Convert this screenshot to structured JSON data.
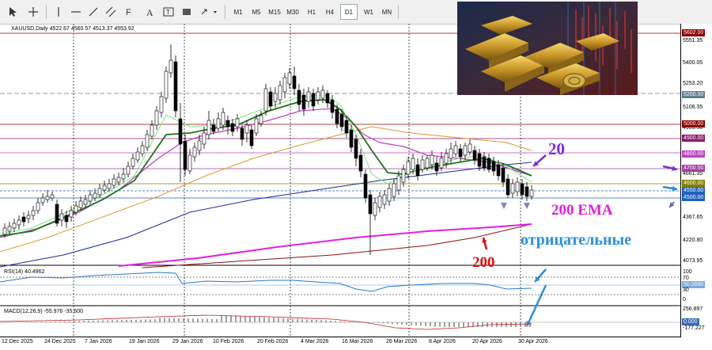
{
  "toolbar": {
    "timeframes": [
      "M1",
      "M5",
      "M15",
      "M30",
      "H1",
      "H4",
      "D1",
      "W1",
      "MN"
    ],
    "active_timeframe": "D1"
  },
  "chart": {
    "header": "XAUUSD,Daily  4522.67 4560.57 4513.37 4553.92",
    "price_labels": [
      "5551.35",
      "5400.05",
      "5253.20",
      "5106.35",
      "4959.50",
      "4661.35",
      "4367.65",
      "4220.80",
      "4073.95"
    ],
    "price_tags": [
      {
        "text": "5602.00",
        "color": "#8b0000"
      },
      {
        "text": "5200.00",
        "color": "#5f7f8f"
      },
      {
        "text": "5000.00",
        "color": "#8b0000"
      },
      {
        "text": "4900.00",
        "color": "#8b1a6b"
      },
      {
        "text": "4800.00",
        "color": "#c040c0"
      },
      {
        "text": "4700.00",
        "color": "#a040a0"
      },
      {
        "text": "4600.00",
        "color": "#808000"
      },
      {
        "text": "4550.00",
        "color": "#2060c0"
      },
      {
        "text": "4500.00",
        "color": "#2060c0"
      }
    ],
    "dates": [
      "12 Dec 2025",
      "24 Dec 2025",
      "7 Jan 2026",
      "19 Jan 2026",
      "29 Jan 2026",
      "10 Feb 2026",
      "20 Feb 2026",
      "4 Mar 2026",
      "16 Mar 2026",
      "26 Mar 2026",
      "8 Apr 2026",
      "20 Apr 2026",
      "30 Apr 2026"
    ]
  },
  "rsi": {
    "title": "RSI(14) 40.4962",
    "levels": [
      "100",
      "70",
      "50.0000",
      "30",
      "0"
    ]
  },
  "macd": {
    "title": "MACD(12,26,9) -55.976 -35.600",
    "levels": [
      "256.897",
      "0.000",
      "-177.227"
    ]
  },
  "annotations": {
    "ema20": "20",
    "ema200_label": "200 EMA",
    "sma200": "200",
    "negative": "отрицательные"
  },
  "colors": {
    "accent_purple": "#7b2fd0",
    "ema200": "#e020e0",
    "annotation_red": "#e01010",
    "annotation_blue": "#2a8fd8"
  }
}
